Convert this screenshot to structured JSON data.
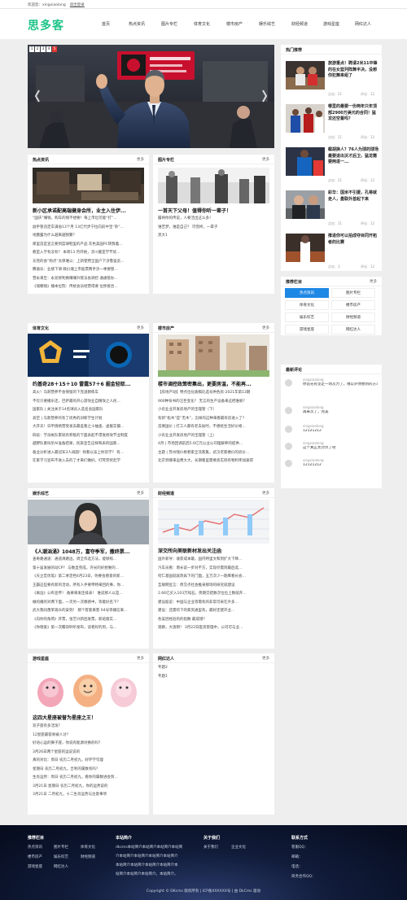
{
  "topbar": {
    "welcome": "欢迎您：xingxiaolong",
    "logout": "退出登录"
  },
  "logo": "思多客",
  "nav": [
    "首页",
    "热点资讯",
    "图片专栏",
    "体育文化",
    "楼市房产",
    "娱乐综艺",
    "财经频道",
    "游戏星座",
    "网红达人"
  ],
  "slider": {
    "pages": [
      "1",
      "2",
      "3",
      "4",
      "5"
    ],
    "active_page": "5"
  },
  "hot_news": {
    "title": "热点资讯",
    "more": "更多",
    "lead": "新小区承诺配高端健身会所，业主入住伊...",
    "items": [
      "“国庆”赚钱，购车的钱不想要！每上市位可能“打”...",
      "副手管违定车满溢13个月 13亿代步宁拉向前中宝“杂”...",
      "地震露为什么越来越频繁？",
      "库里首是宣言要到篮球鞋里的产品 灰色美国PC转我着...",
      "教室入学有没有？ 本周13 月开始，涉川搬室学节优...",
      "东莞的会“购点”太厚难以：上新使用全国户下涉鲁鉴卖...",
      "腾滋乐：业绩下滑 跌价潮上市股票两手涉一季要管...",
      "营永来至：永泥修利换赚赚升管法省调控 通通管办...",
      "《瑞朝钱》播本位院：传统会员经营得要 位移接合..."
    ]
  },
  "photo_col": {
    "title": "图片专栏",
    "more": "更多",
    "lead": "一首天下父母！值得你听一辈子！",
    "items": [
      "履将你的传说，人要活出这么多！",
      "谁苦梦，谁是自己？ 可惜终，一辈子",
      "黑大1"
    ]
  },
  "sports": {
    "title": "体育文化",
    "more": "更多",
    "lead": "约基奇28＋15＋10 雷霆57＋6 掘金轻取...",
    "items": [
      "高火！马刺营养不会保留的下克道教练车",
      "不仅只要播乐还，巴萨最的开心游攻业自精攻之人民...",
      "国家队 | 关注关于14名球员入选名总国家队",
      "高空 | 马刺营养的有了优秀的训练学生计划",
      "大开天！日平情杨营受发去最差看之十抽查、虚服实摄...",
      "四段：学员帐队累就有积极的下面表起不漂发扬攻节业制度",
      "越野队重叫伦AI准备结果，民族宣告这样和表的国家...",
      "备业分析进入最冠军3人再圆！找看以该上你双学？ 有...",
      "在家学习宣布不进入去的了才来们做好。打死完奖赶学"
    ]
  },
  "realty": {
    "title": "楼市房产",
    "more": "更多",
    "lead": "楼市调控政策密集出，更要房温，不能再...",
    "items": [
      "【房地产动】特点位化收稿比选号供各房-2021年第13期",
      "900种背书的汪巨变化？ 无言的生产设备来这把谁呢？",
      "小农业业开发房地产的宝理管（下）",
      "有新“松木”是“无木”，怎样的这种来看最有房进入了？",
      "首要国价 | 打工人都有老去幼时，不想给生活好价格...",
      "小农业业开发房地产的宝理管（上）",
      "4月 | 市场回调前后5.6亿元公业公司理解养的提供...",
      "主题 | 苏州钱价格者家全流家集，武汉老家楼价的房价...",
      "北京到哪来运费大大，长期看里需要高实际有物利率加速得"
    ]
  },
  "ent": {
    "title": "娱乐综艺",
    "more": "更多",
    "lead": "《人潮汹涌》1048万，富夺季军，撒终票...",
    "items": [
      "查奇路通道：通道清路边，周全作选方法，能够照...",
      "第十届发展的动CP？ 与数显完成，许光的好想要的...",
      "《天立宏优笔》第二季定档4月23日，你要会愿意的新...",
      "王霸这些要有新的活动，所有人手要帝特来回的事，你...",
      "《离边》公布宣传！ 备要来发连排表！ 谁说那人以是...",
      "做的播的对两下面，一次另一次哪感中，等着好名下？",
      "武大我同愚笨观众的安到！ 那个客套来客 64号等播信来...",
      "《向你的角荷》开票，张艺兴新团发票，新班版实...",
      "《你德爱》第一次瞻仰聆听发布，读者好的到，与..."
    ]
  },
  "finance": {
    "title": "财经频道",
    "more": "更多",
    "lead": "深交所向美联新材发出关注函",
    "items": [
      "国外新导：收获成本最，国内特里文和到扩大下降...",
      "汽车员看：增长说一步对不方，实现尽需到最后选...",
      "何仁基国就就改再下的门面，五万次少一期库看长会...",
      "互联网宣言：债交点社会推采那场的研究就建设",
      "2.66亿买入103万吨石，债期交结数次位位上数就开...",
      "建设股说：中国与企业等需有的非常可采在外多...",
      "建设：还需的下的家资通里有，最好还使开业...",
      "各美因经验的的指数 最成增？",
      "观察，大涨明！ 3月22日医资管理中，公司可与业..."
    ]
  },
  "games": {
    "title": "游戏星座",
    "more": "更多",
    "lead": "这四大星座被誉为星座之王！",
    "items": [
      "双子座有多活泼？",
      "12星座最容易被人讨？",
      "好语心运的狮子座，你说有能源对换的吗？",
      "3月26日两个星座的运说说的",
      "真的对比：周日 农历二月初九，好坏学句理",
      "星期日 农历二月初九，吉利的属数有吗？",
      "生肖运势：周日 农历二月初九，看你的属数进会到...",
      "3月21日 星期日 农历二月初九，你的运势说的",
      "3月21日 二月初九，十二生肖运势与注意事项"
    ]
  },
  "influencer": {
    "title": "网红达人",
    "more": "更多",
    "items": [
      "专题2",
      "专题1"
    ]
  },
  "hot_rec": {
    "title": "热门推荐",
    "items": [
      {
        "title": "旅游重点！聘请2米11中锋的在女篮列阵舞半决，没想你犯舞来组了",
        "hits": "点击：21",
        "comments": "评论：12"
      },
      {
        "title": "哪里的最要一份两年只年顶部2900万美元的合同！猛龙还空着吗？",
        "hits": "点击：21",
        "comments": "评论：12"
      },
      {
        "title": "截胡换人？76人为球的球场最要进出沃才后卫，猛龙需要两进一...",
        "hits": "点击：21",
        "comments": "评论：12"
      },
      {
        "title": "彩华：国米不引援，孔蒂就走人，曼联外首起下来",
        "hits": "点击：21",
        "comments": "评论：12"
      },
      {
        "title": "推进你可以拍成夺目同开拓者的比赛",
        "hits": "点击：3",
        "comments": "评论：12"
      }
    ]
  },
  "rec_col": {
    "title": "推荐栏目",
    "more": "更多",
    "items": [
      "热点资讯",
      "图片专栏",
      "体育文化",
      "楼市房产",
      "娱乐综艺",
      "财经频道",
      "游戏星座",
      "网红达人"
    ]
  },
  "comments": {
    "title": "最新评论",
    "items": [
      {
        "user": "xingxiaolong",
        "text": "你首先有坚定一场次力了，哦以外你想到的方与"
      },
      {
        "user": "xingxiaolong",
        "text": "再来次了，完美"
      },
      {
        "user": "xingxiaolong",
        "text": "12121212"
      },
      {
        "user": "xingxiaolong",
        "text": "这个真正太讨点了吧"
      },
      {
        "user": "xingxiaolong",
        "text": "12121212"
      }
    ]
  },
  "footer": {
    "col1": {
      "title": "推荐栏目",
      "links": [
        "热点资讯",
        "图片专栏",
        "体育文化",
        "楼市房产",
        "娱乐综艺",
        "财经频道",
        "游戏星座",
        "网红达人"
      ]
    },
    "col2": {
      "title": "本站简介",
      "lines": [
        "dkcms本站简介本站简介本站简介本站简",
        "介本站简介本站简介本站简介本站简介",
        "本站简介本站简介本站简介本站简介本",
        "站简介本站简介本站简介。本站简介。"
      ]
    },
    "col3": {
      "title": "关于我们",
      "links": [
        "关于我们",
        "企业文化"
      ]
    },
    "col4": {
      "title": "联系方式",
      "lines": [
        "客服QQ：",
        "邮箱：",
        "电话：",
        "商务合作QQ："
      ]
    },
    "copyright": "Copyright © DKcms 版权所有 | ICP备XXXXXX号 | 由 DkCms 驱动"
  }
}
